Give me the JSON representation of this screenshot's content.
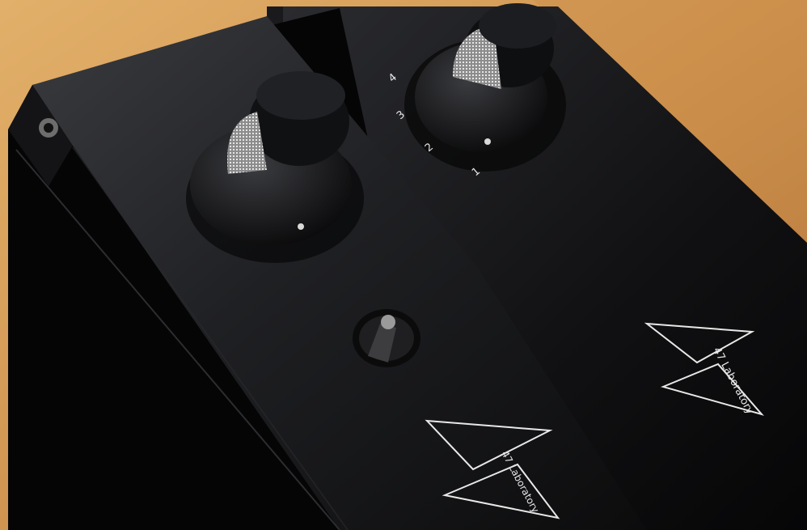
{
  "photo": {
    "subject": "Two black aluminium audio units with knobs and a toggle switch",
    "colors": {
      "wood_light": "#d9a35d",
      "wood_dark": "#b2753a",
      "chassis_top": "#2a2b2e",
      "chassis_side": "#0b0b0c",
      "knob": "#111214",
      "knurl": "#cfcfcf",
      "print": "#e8e8e8"
    }
  },
  "front_unit": {
    "brand_text": "47 Laboratory"
  },
  "rear_unit": {
    "brand_text": "47 Laboratory",
    "selector_positions": [
      "1",
      "2",
      "3",
      "4"
    ]
  }
}
